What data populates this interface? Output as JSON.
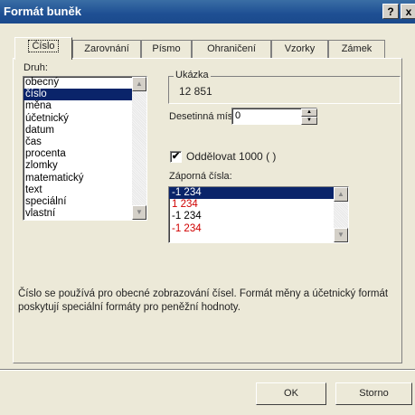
{
  "window": {
    "title": "Formát buněk",
    "help_label": "?",
    "close_label": "x"
  },
  "tabs": [
    {
      "label": "Číslo"
    },
    {
      "label": "Zarovnání"
    },
    {
      "label": "Písmo"
    },
    {
      "label": "Ohraničení"
    },
    {
      "label": "Vzorky"
    },
    {
      "label": "Zámek"
    }
  ],
  "category": {
    "label": "Druh:",
    "items": [
      "obecný",
      "číslo",
      "měna",
      "účetnický",
      "datum",
      "čas",
      "procenta",
      "zlomky",
      "matematický",
      "text",
      "speciální",
      "vlastní"
    ],
    "selected_index": 1
  },
  "sample": {
    "label": "Ukázka",
    "value": "12 851"
  },
  "decimals": {
    "label": "Desetinná místa:",
    "value": "0"
  },
  "thousands": {
    "label": "Oddělovat 1000 ( )",
    "checked": true
  },
  "negative": {
    "label": "Záporná čísla:",
    "items": [
      {
        "text": "-1 234",
        "color": "#000000",
        "selected": true
      },
      {
        "text": "1 234",
        "color": "#d00000",
        "selected": false
      },
      {
        "text": "-1 234",
        "color": "#000000",
        "selected": false
      },
      {
        "text": "-1 234",
        "color": "#d00000",
        "selected": false
      }
    ]
  },
  "description": "Číslo se používá pro obecné zobrazování čísel. Formát měny a účetnický formát poskytují speciální formáty pro peněžní hodnoty.",
  "buttons": {
    "ok": "OK",
    "cancel": "Storno"
  }
}
